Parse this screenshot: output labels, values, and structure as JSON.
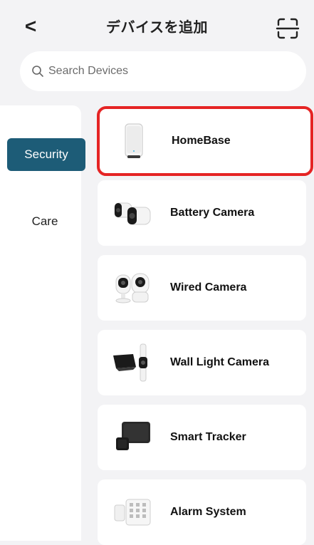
{
  "header": {
    "title": "デバイスを追加",
    "back_glyph": "<",
    "back_icon": "chevron-left-icon",
    "scan_icon": "scan-icon"
  },
  "search": {
    "placeholder": "Search Devices",
    "icon": "search-icon"
  },
  "sidebar": {
    "items": [
      {
        "label": "Security",
        "active": true
      },
      {
        "label": "Care",
        "active": false
      }
    ],
    "active_color": "#1d5c77"
  },
  "devices": [
    {
      "label": "HomeBase",
      "icon": "homebase-icon",
      "selected": true
    },
    {
      "label": "Battery Camera",
      "icon": "battery-camera-icon",
      "selected": false
    },
    {
      "label": "Wired Camera",
      "icon": "wired-camera-icon",
      "selected": false
    },
    {
      "label": "Wall Light Camera",
      "icon": "wall-light-camera-icon",
      "selected": false
    },
    {
      "label": "Smart Tracker",
      "icon": "smart-tracker-icon",
      "selected": false
    },
    {
      "label": "Alarm System",
      "icon": "alarm-system-icon",
      "selected": false
    }
  ],
  "colors": {
    "background": "#f3f3f5",
    "selection_outline": "#e52424"
  }
}
